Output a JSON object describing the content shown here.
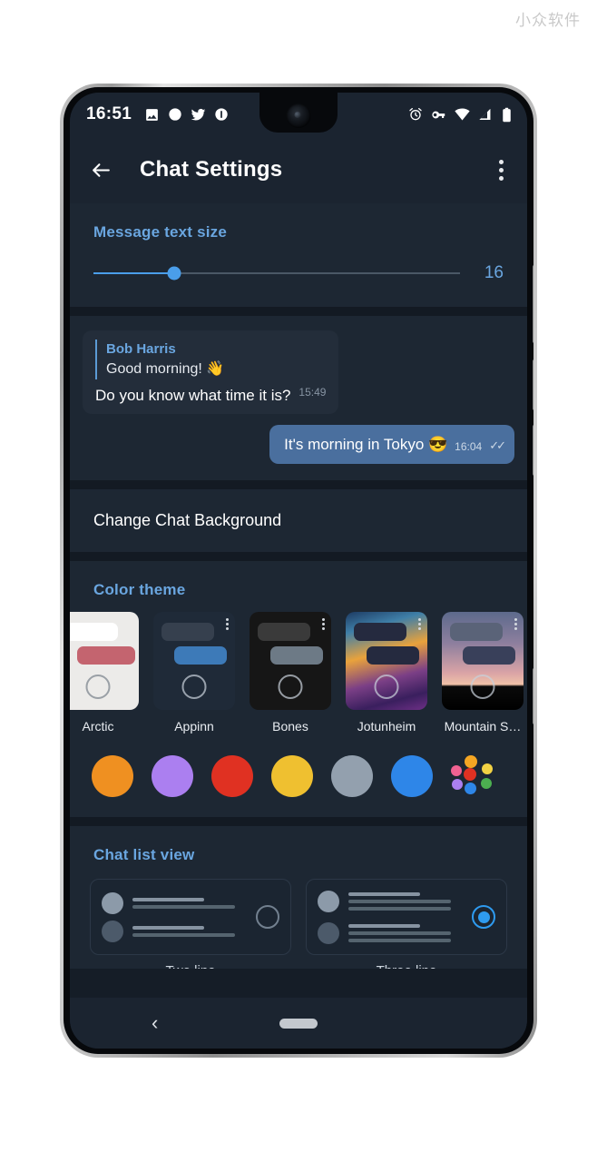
{
  "watermark": "小众软件",
  "status_bar": {
    "time": "16:51",
    "left_icons": [
      "image-icon",
      "circle-icon",
      "twitter-icon",
      "info-icon"
    ],
    "right_icons": [
      "alarm-icon",
      "vpn-key-icon",
      "wifi-icon",
      "signal-icon",
      "battery-icon"
    ]
  },
  "toolbar": {
    "back_icon": "back-arrow-icon",
    "title": "Chat Settings",
    "overflow_icon": "more-vert-icon"
  },
  "text_size": {
    "title": "Message text size",
    "value": "16",
    "fill_percent": 22
  },
  "chat_preview": {
    "incoming": {
      "reply_name": "Bob Harris",
      "reply_text": "Good morning! 👋",
      "message": "Do you know what time it is?",
      "time": "15:49"
    },
    "outgoing": {
      "message": "It's morning in Tokyo 😎",
      "time": "16:04",
      "status_icon": "double-check-icon"
    }
  },
  "change_background": {
    "label": "Change Chat Background"
  },
  "color_theme": {
    "title": "Color theme",
    "themes": [
      {
        "name": "Arctic",
        "card_bg": "#ecebe9",
        "bubble1": "#ffffff",
        "bubble2": "#c4646f",
        "dots": false
      },
      {
        "name": "Appinn",
        "card_bg": "#1f2a38",
        "bubble1": "#36404e",
        "bubble2": "#3d7ab8",
        "dots": true
      },
      {
        "name": "Bones",
        "card_bg": "#161616",
        "bubble1": "#3a3a3a",
        "bubble2": "#6d7a86",
        "dots": true
      },
      {
        "name": "Jotunheim",
        "card_bg": "#2a2150",
        "bubble1": "#252a3f",
        "bubble2": "#252a3f",
        "dots": true
      },
      {
        "name": "Mountain S…",
        "card_bg": "#8b7a94",
        "bubble1": "#5a6378",
        "bubble2": "#39405a",
        "dots": true
      }
    ],
    "swatches": [
      "#ef9021",
      "#ab7ff0",
      "#e03122",
      "#efc030",
      "#93a0ae",
      "#2e86e8"
    ],
    "custom_swatch_icon": "multicolor-palette-icon"
  },
  "chat_list_view": {
    "title": "Chat list view",
    "options": [
      {
        "label": "Two line",
        "selected": false
      },
      {
        "label": "Three line",
        "selected": true
      }
    ]
  },
  "nav_bar": {
    "back_icon": "nav-back-icon",
    "home_icon": "nav-home-pill"
  }
}
